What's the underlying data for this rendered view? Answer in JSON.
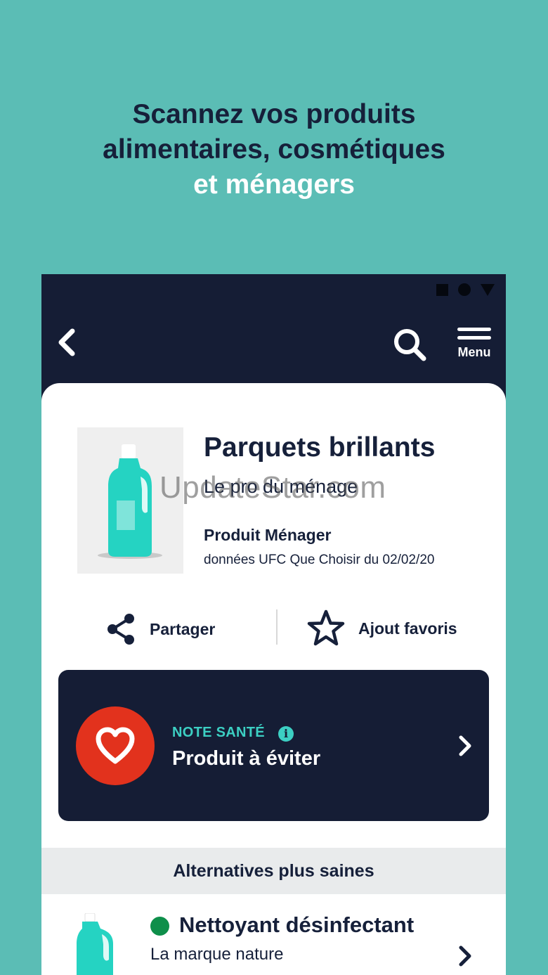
{
  "headline": {
    "line1": "Scannez vos produits",
    "line2": "alimentaires, cosmétiques",
    "line3": "et ménagers"
  },
  "topbar": {
    "back_icon": "chevron-left-icon",
    "search_icon": "search-icon",
    "menu_label": "Menu"
  },
  "product": {
    "name": "Parquets brillants",
    "brand": "Le pro du ménage",
    "category": "Produit Ménager",
    "source": "données UFC Que Choisir du 02/02/20",
    "image_icon": "detergent-bottle-icon"
  },
  "watermark": "UpdateStar.com",
  "actions": {
    "share_label": "Partager",
    "favorite_label": "Ajout favoris"
  },
  "health_note": {
    "tag": "NOTE SANTÉ",
    "info_icon": "i",
    "value": "Produit à éviter",
    "icon": "heart-icon"
  },
  "alternatives": {
    "header": "Alternatives plus saines",
    "items": [
      {
        "name": "Nettoyant désinfectant",
        "brand": "La marque nature",
        "status_color": "#0e8f4a"
      }
    ]
  },
  "colors": {
    "background": "#5bbdb5",
    "navy": "#16203a",
    "teal_accent": "#3ccfc3",
    "danger": "#e2321d",
    "good": "#0e8f4a"
  }
}
